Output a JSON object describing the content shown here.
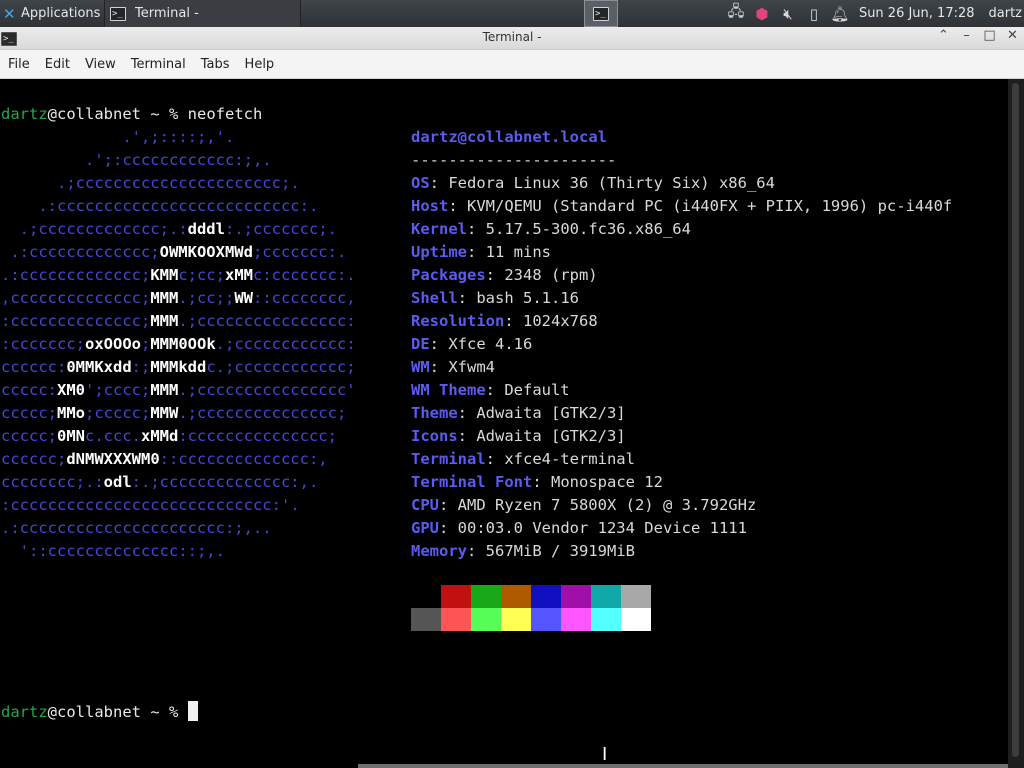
{
  "panel": {
    "applications_label": "Applications",
    "task_label": "Terminal -",
    "clock": "Sun 26 Jun, 17:28",
    "user": "dartz",
    "tray_icons": [
      "network-icon",
      "package-icon",
      "volume-muted-icon",
      "battery-icon",
      "notification-bell-icon"
    ]
  },
  "window": {
    "title": "Terminal -",
    "buttons": {
      "shade": "⌃",
      "minimize": "–",
      "maximize": "□",
      "close": "✕"
    }
  },
  "menu": [
    "File",
    "Edit",
    "View",
    "Terminal",
    "Tabs",
    "Help"
  ],
  "prompt": {
    "user": "dartz",
    "host": "@collabnet",
    "path": " ~ % ",
    "command": "neofetch"
  },
  "logo": [
    "             .',;::::;,'.",
    "         .';:cccccccccccc:;,.",
    "      .;cccccccccccccccccccccc;.",
    "    .:cccccccccccccccccccccccccc:.",
    "  .;ccccccccccccc;.:dddl:.;ccccccc;.",
    " .:ccccccccccccc;OWMKOOXMWd;ccccccc:.",
    ".:ccccccccccccc;KMMc;cc;xMMc:ccccccc:.",
    ",cccccccccccccc;MMM.;cc;;WW::cccccccc,",
    ":cccccccccccccc;MMM.;cccccccccccccccc:",
    ":ccccccc;oxOOOo;MMM0OOk.;cccccccccccc:",
    "cccccc:0MMKxdd:;MMMkddc.;cccccccccccc;",
    "ccccc:XM0';cccc;MMM.;cccccccccccccccc'",
    "ccccc;MMo;ccccc;MMW.;ccccccccccccccc;",
    "ccccc;0MNc.ccc.xMMd:ccccccccccccccc;",
    "cccccc;dNMWXXXWM0::cccccccccccccc:,",
    "cccccccc;.:odl:.;cccccccccccccc:,.",
    ":cccccccccccccccccccccccccccc:'.",
    ".:cccccccccccccccccccccc:;,..",
    "  '::cccccccccccccc::;,."
  ],
  "info": {
    "user": "dartz",
    "host": "@collabnet.local",
    "separator": "----------------------",
    "rows": [
      {
        "key": "OS",
        "value": ": Fedora Linux 36 (Thirty Six) x86_64"
      },
      {
        "key": "Host",
        "value": ": KVM/QEMU (Standard PC (i440FX + PIIX, 1996) pc-i440f"
      },
      {
        "key": "Kernel",
        "value": ": 5.17.5-300.fc36.x86_64"
      },
      {
        "key": "Uptime",
        "value": ": 11 mins"
      },
      {
        "key": "Packages",
        "value": ": 2348 (rpm)"
      },
      {
        "key": "Shell",
        "value": ": bash 5.1.16"
      },
      {
        "key": "Resolution",
        "value": ": 1024x768"
      },
      {
        "key": "DE",
        "value": ": Xfce 4.16"
      },
      {
        "key": "WM",
        "value": ": Xfwm4"
      },
      {
        "key": "WM Theme",
        "value": ": Default"
      },
      {
        "key": "Theme",
        "value": ": Adwaita [GTK2/3]"
      },
      {
        "key": "Icons",
        "value": ": Adwaita [GTK2/3]"
      },
      {
        "key": "Terminal",
        "value": ": xfce4-terminal"
      },
      {
        "key": "Terminal Font",
        "value": ": Monospace 12"
      },
      {
        "key": "CPU",
        "value": ": AMD Ryzen 7 5800X (2) @ 3.792GHz"
      },
      {
        "key": "GPU",
        "value": ": 00:03.0 Vendor 1234 Device 1111"
      },
      {
        "key": "Memory",
        "value": ": 567MiB / 3919MiB"
      }
    ]
  },
  "palette": [
    "#000000",
    "#c01010",
    "#18a818",
    "#b05a00",
    "#1010c0",
    "#a010a8",
    "#10a8a8",
    "#a8a8a8",
    "#555555",
    "#ff5555",
    "#55ff55",
    "#ffff55",
    "#5555ff",
    "#ff55ff",
    "#55ffff",
    "#ffffff"
  ],
  "colors": {
    "prompt_user": "#27a54b",
    "logo_blue": "#4646d6",
    "info_key": "#5b5bf0"
  }
}
